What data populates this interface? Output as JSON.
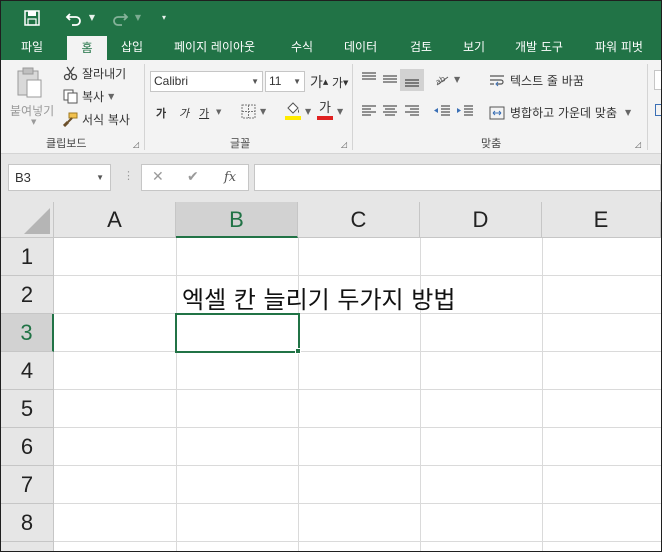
{
  "quick_access": {
    "save_icon": "save-icon",
    "undo_icon": "undo-icon",
    "redo_icon": "redo-icon",
    "customize_icon": "customize-qat-icon"
  },
  "tabs": [
    {
      "label": "파일"
    },
    {
      "label": "홈"
    },
    {
      "label": "삽입"
    },
    {
      "label": "페이지 레이아웃"
    },
    {
      "label": "수식"
    },
    {
      "label": "데이터"
    },
    {
      "label": "검토"
    },
    {
      "label": "보기"
    },
    {
      "label": "개발 도구"
    },
    {
      "label": "파워 피벗"
    }
  ],
  "active_tab": "홈",
  "clipboard": {
    "paste": "붙여넣기",
    "cut": "잘라내기",
    "copy": "복사",
    "format_painter": "서식 복사",
    "group_label": "클립보드"
  },
  "font": {
    "name": "Calibri",
    "size": "11",
    "increase": "가",
    "decrease": "가",
    "bold": "가",
    "italic": "가",
    "underline": "가",
    "font_color_glyph": "가",
    "group_label": "글꼴"
  },
  "alignment": {
    "wrap_text": "텍스트 줄 바꿈",
    "merge_center": "병합하고 가운데 맞춤",
    "group_label": "맞춤"
  },
  "formula_bar": {
    "name_box": "B3",
    "fx": "fx",
    "formula": ""
  },
  "columns": [
    "A",
    "B",
    "C",
    "D",
    "E"
  ],
  "rows": [
    "1",
    "2",
    "3",
    "4",
    "5",
    "6",
    "7",
    "8"
  ],
  "selected_column": "B",
  "selected_row": "3",
  "cells": {
    "B2": "엑셀 칸 늘리기 두가지 방법"
  },
  "colors": {
    "accent": "#217346",
    "font_color_underline": "#e02020",
    "highlight_underline": "#ffeb00"
  }
}
